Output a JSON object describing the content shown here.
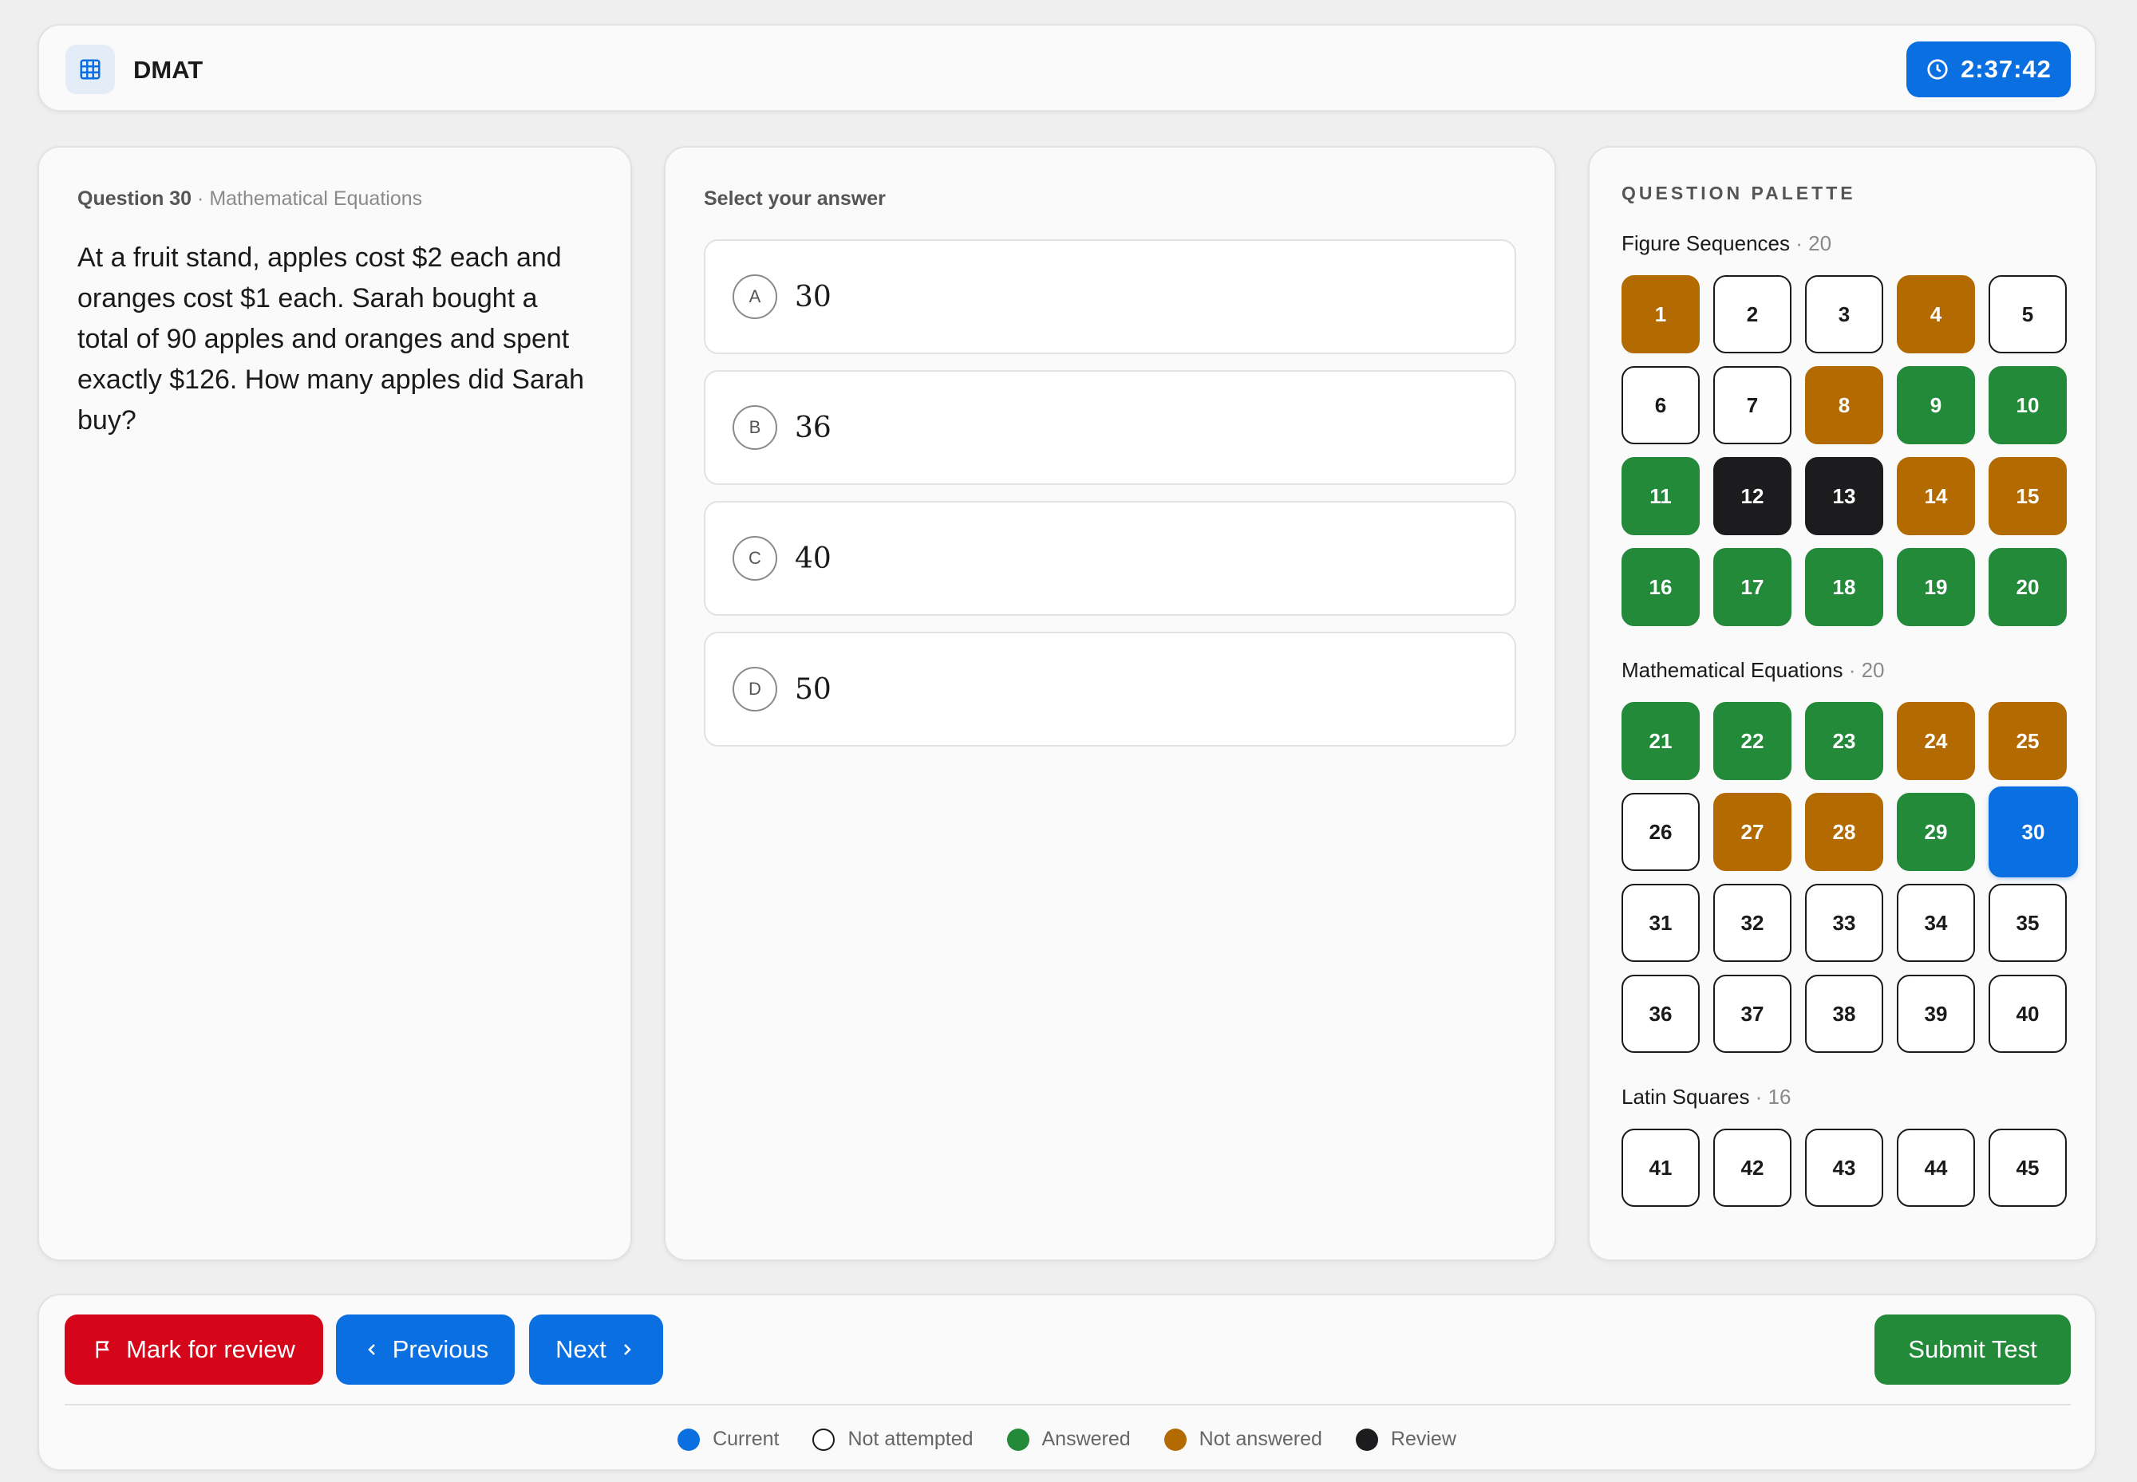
{
  "header": {
    "app_title": "DMAT",
    "timer": "2:37:42"
  },
  "question": {
    "label": "Question 30",
    "separator": " · ",
    "section": "Mathematical Equations",
    "text": "At a fruit stand, apples cost $2 each and oranges cost $1 each. Sarah bought a total of 90 apples and oranges and spent exactly $126. How many apples did Sarah buy?"
  },
  "answers": {
    "label": "Select your answer",
    "options": [
      {
        "letter": "A",
        "value": "30"
      },
      {
        "letter": "B",
        "value": "36"
      },
      {
        "letter": "C",
        "value": "40"
      },
      {
        "letter": "D",
        "value": "50"
      }
    ]
  },
  "palette": {
    "title": "QUESTION PALETTE",
    "sections": [
      {
        "name": "Figure Sequences",
        "count": " · 20",
        "cells": [
          {
            "n": "1",
            "s": "notanswered"
          },
          {
            "n": "2",
            "s": "notattempted"
          },
          {
            "n": "3",
            "s": "notattempted"
          },
          {
            "n": "4",
            "s": "notanswered"
          },
          {
            "n": "5",
            "s": "notattempted"
          },
          {
            "n": "6",
            "s": "notattempted"
          },
          {
            "n": "7",
            "s": "notattempted"
          },
          {
            "n": "8",
            "s": "notanswered"
          },
          {
            "n": "9",
            "s": "answered"
          },
          {
            "n": "10",
            "s": "answered"
          },
          {
            "n": "11",
            "s": "answered"
          },
          {
            "n": "12",
            "s": "review"
          },
          {
            "n": "13",
            "s": "review"
          },
          {
            "n": "14",
            "s": "notanswered"
          },
          {
            "n": "15",
            "s": "notanswered"
          },
          {
            "n": "16",
            "s": "answered"
          },
          {
            "n": "17",
            "s": "answered"
          },
          {
            "n": "18",
            "s": "answered"
          },
          {
            "n": "19",
            "s": "answered"
          },
          {
            "n": "20",
            "s": "answered"
          }
        ]
      },
      {
        "name": "Mathematical Equations",
        "count": " · 20",
        "cells": [
          {
            "n": "21",
            "s": "answered"
          },
          {
            "n": "22",
            "s": "answered"
          },
          {
            "n": "23",
            "s": "answered"
          },
          {
            "n": "24",
            "s": "notanswered"
          },
          {
            "n": "25",
            "s": "notanswered"
          },
          {
            "n": "26",
            "s": "notattempted"
          },
          {
            "n": "27",
            "s": "notanswered"
          },
          {
            "n": "28",
            "s": "notanswered"
          },
          {
            "n": "29",
            "s": "answered"
          },
          {
            "n": "30",
            "s": "current"
          },
          {
            "n": "31",
            "s": "notattempted"
          },
          {
            "n": "32",
            "s": "notattempted"
          },
          {
            "n": "33",
            "s": "notattempted"
          },
          {
            "n": "34",
            "s": "notattempted"
          },
          {
            "n": "35",
            "s": "notattempted"
          },
          {
            "n": "36",
            "s": "notattempted"
          },
          {
            "n": "37",
            "s": "notattempted"
          },
          {
            "n": "38",
            "s": "notattempted"
          },
          {
            "n": "39",
            "s": "notattempted"
          },
          {
            "n": "40",
            "s": "notattempted"
          }
        ]
      },
      {
        "name": "Latin Squares",
        "count": " · 16",
        "cells": [
          {
            "n": "41",
            "s": "notattempted"
          },
          {
            "n": "42",
            "s": "notattempted"
          },
          {
            "n": "43",
            "s": "notattempted"
          },
          {
            "n": "44",
            "s": "notattempted"
          },
          {
            "n": "45",
            "s": "notattempted"
          }
        ]
      }
    ]
  },
  "footer": {
    "mark_review": "Mark for review",
    "previous": "Previous",
    "next": "Next",
    "submit": "Submit Test"
  },
  "legend": [
    {
      "key": "current",
      "label": "Current"
    },
    {
      "key": "notattempted",
      "label": "Not attempted"
    },
    {
      "key": "answered",
      "label": "Answered"
    },
    {
      "key": "notanswered",
      "label": "Not answered"
    },
    {
      "key": "review",
      "label": "Review"
    }
  ],
  "colors": {
    "primary": "#0a6fe0",
    "answered": "#238a3a",
    "not_answered": "#b36a00",
    "review": "#1c1c1e",
    "danger": "#d6061a"
  },
  "icons": {
    "logo": "grid-icon",
    "timer": "clock-icon",
    "mark_review": "flag-icon",
    "previous": "chevron-left-icon",
    "next": "chevron-right-icon"
  }
}
